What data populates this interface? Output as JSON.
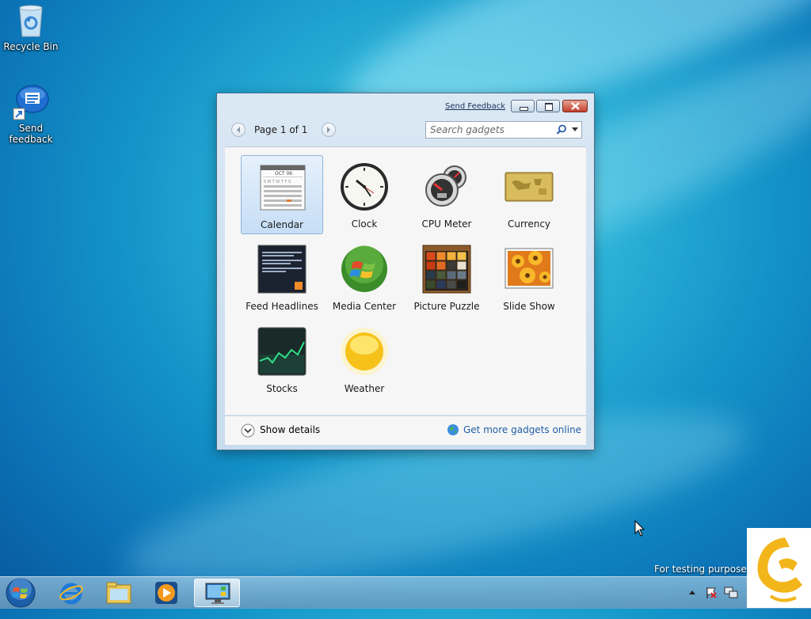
{
  "desktop": {
    "icons": [
      {
        "label": "Recycle Bin"
      },
      {
        "label_line1": "Send",
        "label_line2": "feedback"
      }
    ]
  },
  "gadget_window": {
    "send_feedback": "Send Feedback",
    "page_info": "Page 1 of 1",
    "search_placeholder": "Search gadgets",
    "gadgets": [
      {
        "label": "Calendar",
        "selected": true
      },
      {
        "label": "Clock"
      },
      {
        "label": "CPU Meter"
      },
      {
        "label": "Currency"
      },
      {
        "label": "Feed Headlines"
      },
      {
        "label": "Media Center"
      },
      {
        "label": "Picture Puzzle"
      },
      {
        "label": "Slide Show"
      },
      {
        "label": "Stocks"
      },
      {
        "label": "Weather"
      }
    ],
    "calendar_month": "OCT 06",
    "calendar_weekdays": [
      "S",
      "M",
      "T",
      "W",
      "T",
      "F",
      "S"
    ],
    "show_details": "Show details",
    "get_more": "Get more gadgets online"
  },
  "taskbar": {
    "items": [
      "start-button",
      "internet-explorer",
      "windows-explorer",
      "media-player",
      "desktop-gadget-gallery"
    ],
    "active_item": "desktop-gadget-gallery"
  },
  "notification_text": "For testing purposes o",
  "colors": {
    "link": "#1f5fa6",
    "selection": "#c6def6",
    "close": "#c13f2c"
  }
}
